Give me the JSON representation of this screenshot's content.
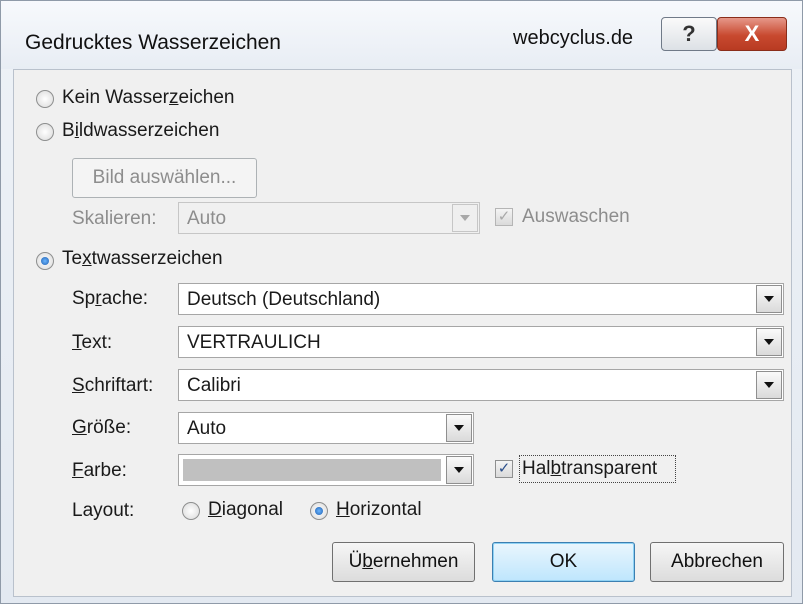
{
  "window": {
    "title": "Gedrucktes Wasserzeichen",
    "watermark_text": "webcyclus.de",
    "help_label": "?",
    "close_label": "X"
  },
  "options": {
    "none_pre": "Kein Wasser",
    "none_ul": "z",
    "none_post": "eichen",
    "picture_pre": "B",
    "picture_ul": "i",
    "picture_post": "ldwasserzeichen",
    "text_pre": "Te",
    "text_ul": "x",
    "text_post": "twasserzeichen",
    "selected": "text"
  },
  "picture": {
    "select_button": "Bild auswählen...",
    "scale_label": "Skalieren:",
    "scale_value": "Auto",
    "washout_label": "Auswaschen",
    "washout_checked": true
  },
  "text_watermark": {
    "language_pre": "Sp",
    "language_ul": "r",
    "language_post": "ache:",
    "language_value": "Deutsch (Deutschland)",
    "text_ul": "T",
    "text_post": "ext:",
    "text_value": "VERTRAULICH",
    "font_ul": "S",
    "font_post": "chriftart:",
    "font_value": "Calibri",
    "size_ul": "G",
    "size_post": "röße:",
    "size_value": "Auto",
    "color_ul": "F",
    "color_post": "arbe:",
    "color_swatch": "#c0c0c0",
    "semitransparent_pre": "Hal",
    "semitransparent_ul": "b",
    "semitransparent_post": "transparent",
    "semitransparent_checked": true,
    "layout_label": "Layout:",
    "diagonal_ul": "D",
    "diagonal_post": "iagonal",
    "horizontal_ul": "H",
    "horizontal_post": "orizontal",
    "layout_selected": "horizontal"
  },
  "buttons": {
    "apply_pre": "Ü",
    "apply_ul": "b",
    "apply_post": "ernehmen",
    "ok": "OK",
    "cancel": "Abbrechen"
  },
  "icons": {
    "check": "✓"
  }
}
